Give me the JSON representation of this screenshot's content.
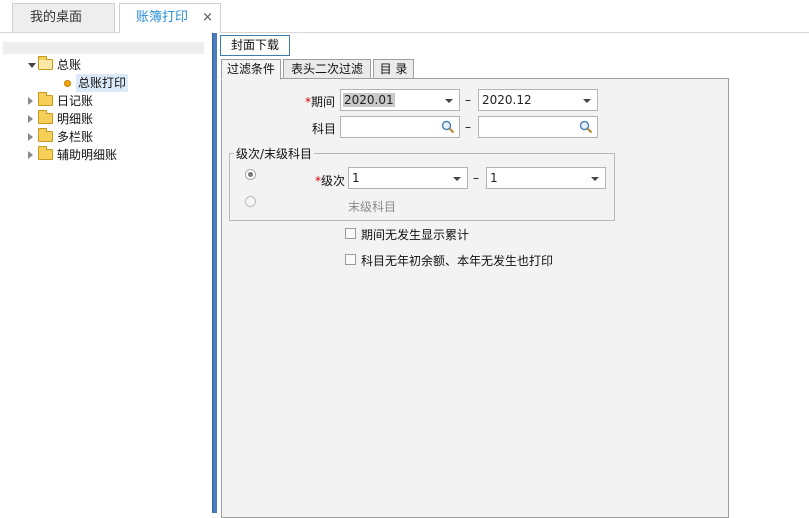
{
  "tabs": {
    "desktop": "我的桌面",
    "ledger_print": "账簿打印",
    "close": "×"
  },
  "tree": {
    "general_ledger": "总账",
    "general_ledger_print": "总账打印",
    "journal": "日记账",
    "detail_ledger": "明细账",
    "multi_column": "多栏账",
    "aux_detail": "辅助明细账"
  },
  "toolbar": {
    "cover_download": "封面下载"
  },
  "subtabs": {
    "filter": "过滤条件",
    "header_filter": "表头二次过滤",
    "catalog": "目 录"
  },
  "filter": {
    "required_mark": "*",
    "period_label": "期间",
    "period_from": "2020.01",
    "period_to": "2020.12",
    "subject_label": "科目",
    "subject_from": "",
    "subject_to": "",
    "range_dash": "–",
    "group_title": "级次/末级科目",
    "level_label": "级次",
    "level_from": "1",
    "level_to": "1",
    "last_level_label": "末级科目",
    "opt_show_cumulative": "期间无发生显示累计",
    "opt_print_empty": "科目无年初余额、本年无发生也打印"
  }
}
